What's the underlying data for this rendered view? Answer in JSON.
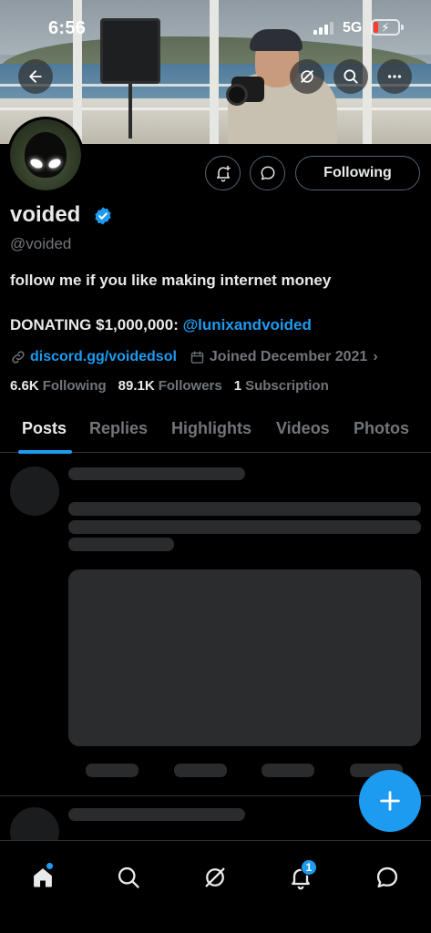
{
  "status_bar": {
    "time": "6:56",
    "network": "5G",
    "battery_level": 0.2
  },
  "header_actions": {
    "back_icon": "arrow-left-icon",
    "grok_icon": "grok-icon",
    "search_icon": "search-icon",
    "more_icon": "more-horizontal-icon"
  },
  "profile": {
    "display_name": "voided",
    "handle": "@voided",
    "verified": true,
    "bio_line1": "follow me if you like making internet money",
    "bio_line2_prefix": "DONATING $1,000,000: ",
    "bio_line2_mention": "@lunixandvoided",
    "website": "discord.gg/voidedsol",
    "joined": "Joined December 2021",
    "following_count": "6.6K",
    "following_label": "Following",
    "followers_count": "89.1K",
    "followers_label": "Followers",
    "subscriptions_count": "1",
    "subscriptions_label": "Subscription"
  },
  "actions": {
    "follow_button_label": "Following",
    "notify_icon": "bell-plus-icon",
    "message_icon": "message-icon"
  },
  "tabs": [
    {
      "label": "Posts",
      "active": true
    },
    {
      "label": "Replies",
      "active": false
    },
    {
      "label": "Highlights",
      "active": false
    },
    {
      "label": "Videos",
      "active": false
    },
    {
      "label": "Photos",
      "active": false
    }
  ],
  "fab": {
    "icon": "plus-icon"
  },
  "bottom_nav": {
    "items": [
      {
        "icon": "home-icon",
        "has_dot": true
      },
      {
        "icon": "search-icon"
      },
      {
        "icon": "grok-icon"
      },
      {
        "icon": "bell-icon",
        "badge": "1"
      },
      {
        "icon": "message-icon"
      }
    ]
  },
  "colors": {
    "accent": "#1d9bf0",
    "background": "#000000",
    "text_primary": "#e7e9ea",
    "text_secondary": "#71767b",
    "border": "#2f3336"
  }
}
